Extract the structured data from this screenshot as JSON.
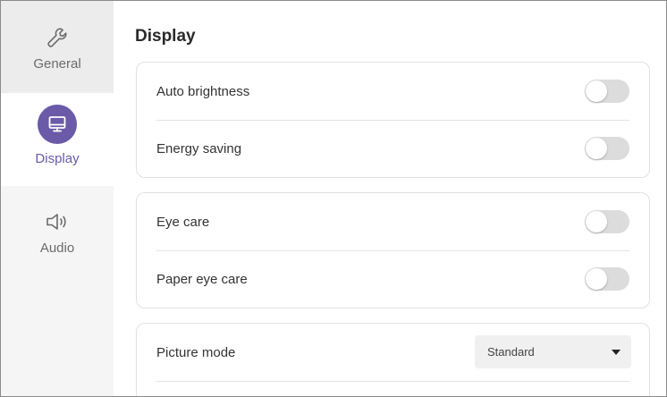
{
  "theme": {
    "accent": "#6a5aa8",
    "toggle_off": "#dcdcdc"
  },
  "sidebar": {
    "items": [
      {
        "label": "General",
        "icon": "wrench-icon",
        "selected": false
      },
      {
        "label": "Display",
        "icon": "monitor-icon",
        "selected": true
      },
      {
        "label": "Audio",
        "icon": "speaker-icon",
        "selected": false
      }
    ]
  },
  "main": {
    "title": "Display",
    "cards": [
      {
        "rows": [
          {
            "label": "Auto brightness",
            "type": "toggle",
            "on": false
          },
          {
            "label": "Energy saving",
            "type": "toggle",
            "on": false
          }
        ]
      },
      {
        "rows": [
          {
            "label": "Eye care",
            "type": "toggle",
            "on": false
          },
          {
            "label": "Paper eye care",
            "type": "toggle",
            "on": false
          }
        ]
      },
      {
        "rows": [
          {
            "label": "Picture mode",
            "type": "select",
            "value": "Standard"
          }
        ]
      }
    ]
  }
}
